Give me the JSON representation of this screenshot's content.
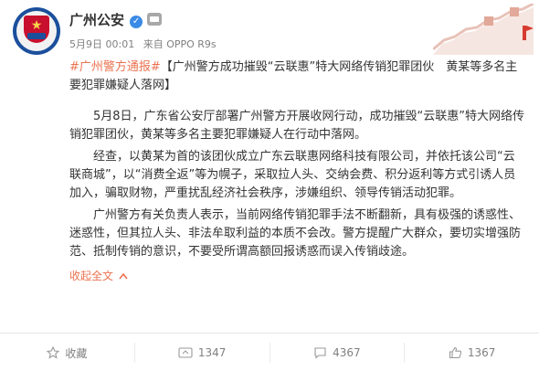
{
  "post": {
    "author": "广州公安",
    "verified_icon": "verified-badge-icon",
    "vip_icon": "vip-icon",
    "date": "5月9日 00:01",
    "source": "来自 OPPO R9s",
    "hashtag": "#广州警方通报#",
    "title": "【广州警方成功摧毁“云联惠”特大网络传销犯罪团伙　黄某等多名主要犯罪嫌疑人落网】",
    "paragraphs": [
      "5月8日，广东省公安厅部署广州警方开展收网行动，成功摧毁“云联惠”特大网络传销犯罪团伙，黄某等多名主要犯罪嫌疑人在行动中落网。",
      "经查，以黄某为首的该团伙成立广东云联惠网络科技有限公司，并依托该公司“云联商城”，以“消费全返”等为幌子，采取拉人头、交纳会费、积分返利等方式引诱人员加入，骗取财物，严重扰乱经济社会秩序，涉嫌组织、领导传销活动犯罪。",
      "广州警方有关负责人表示，当前网络传销犯罪手法不断翻新，具有极强的诱惑性、迷惑性，但其拉人头、非法牟取利益的本质不会改。警方提醒广大群众，要切实增强防范、抵制传销的意识，不要受所谓高额回报诱惑而误入传销歧途。"
    ],
    "collapse_label": "收起全文",
    "collapse_icon": "collapse-icon"
  },
  "actions": [
    {
      "label": "收藏",
      "icon": "star-icon"
    },
    {
      "label": "1347",
      "icon": "repost-icon"
    },
    {
      "label": "4367",
      "icon": "comment-icon"
    },
    {
      "label": "1367",
      "icon": "like-icon"
    }
  ],
  "colors": {
    "hashtag": "#eb7350",
    "text": "#333333",
    "meta": "#808080",
    "verified": "#3b8be6"
  }
}
